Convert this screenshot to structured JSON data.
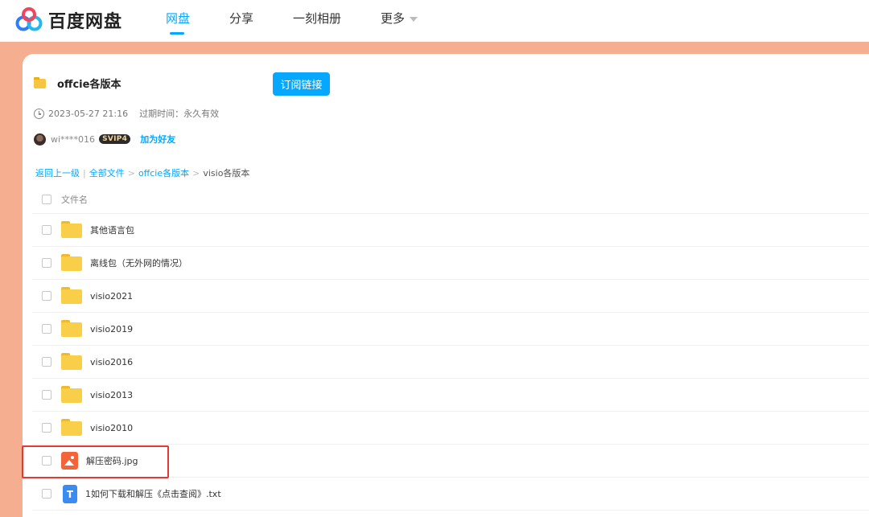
{
  "app": {
    "name": "百度网盘"
  },
  "nav": {
    "items": [
      "网盘",
      "分享",
      "一刻相册",
      "更多"
    ],
    "active_index": 0
  },
  "share": {
    "title": "offcie各版本",
    "subscribe_label": "订阅链接",
    "created": "2023-05-27 21:16",
    "expiry_label": "过期时间：",
    "expiry_value": "永久有效",
    "username": "wi****016",
    "badge": "SVIP4",
    "add_friend_label": "加为好友"
  },
  "breadcrumb": {
    "back": "返回上一级",
    "divider": "|",
    "items": [
      "全部文件",
      "offcie各版本"
    ],
    "current": "visio各版本",
    "separator": ">"
  },
  "list": {
    "header": "文件名",
    "files": [
      {
        "name": "其他语言包",
        "type": "folder"
      },
      {
        "name": "离线包（无外网的情况）",
        "type": "folder"
      },
      {
        "name": "visio2021",
        "type": "folder"
      },
      {
        "name": "visio2019",
        "type": "folder"
      },
      {
        "name": "visio2016",
        "type": "folder"
      },
      {
        "name": "visio2013",
        "type": "folder"
      },
      {
        "name": "visio2010",
        "type": "folder"
      },
      {
        "name": "解压密码.jpg",
        "type": "image",
        "highlighted": true
      },
      {
        "name": "1如何下载和解压《点击查阅》.txt",
        "type": "txt",
        "icon_letter": "T"
      }
    ]
  },
  "colors": {
    "accent": "#06a7ff",
    "background": "#f5ae90",
    "highlight": "#e53935",
    "folder": "#f9cf4a"
  }
}
